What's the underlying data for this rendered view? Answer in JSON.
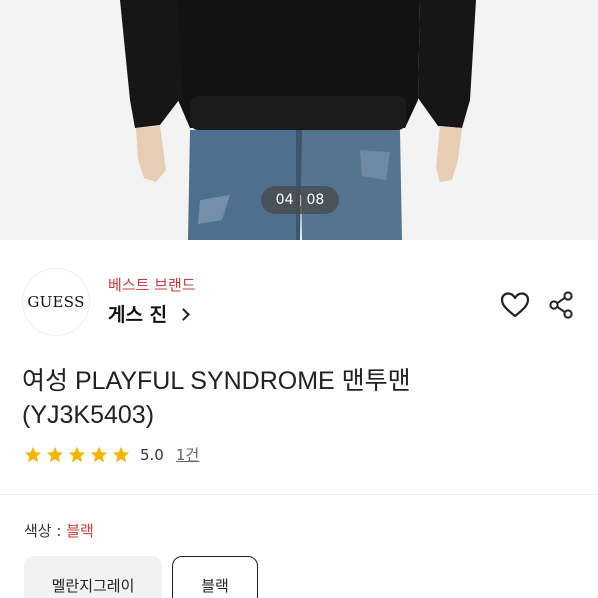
{
  "gallery": {
    "current": "04",
    "total": "08"
  },
  "brand": {
    "logo_text": "GUESS",
    "tag": "베스트 브랜드",
    "name": "게스 진"
  },
  "product": {
    "title": "여성 PLAYFUL SYNDROME 맨투맨(YJ3K5403)"
  },
  "rating": {
    "stars": 5,
    "score": "5.0",
    "count": "1건",
    "star_color": "#f4b400"
  },
  "color": {
    "label": "색상 : ",
    "selected": "블랙",
    "options": [
      "멜란지그레이",
      "블랙"
    ]
  },
  "colors": {
    "accent": "#d03a3a"
  },
  "icons": [
    "heart-icon",
    "share-icon",
    "chevron-right-icon",
    "star-icon"
  ]
}
